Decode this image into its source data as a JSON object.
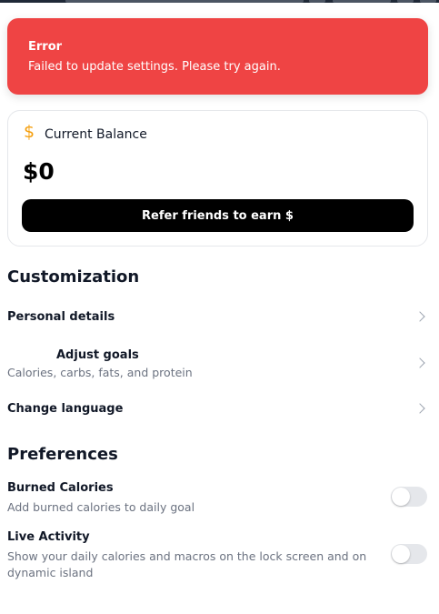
{
  "toast": {
    "title": "Error",
    "message": "Failed to update settings. Please try again.",
    "color": "#ef4444"
  },
  "balance": {
    "icon": "dollar-icon",
    "currency_symbol": "$",
    "label": "Current Balance",
    "amount": "$0",
    "refer_button": "Refer friends to earn $"
  },
  "customization": {
    "title": "Customization",
    "items": [
      {
        "title": "Personal details",
        "icon": "chevron-right-icon"
      },
      {
        "title": "Adjust goals",
        "subtitle": "Calories, carbs, fats, and protein",
        "icon": "chevron-right-icon"
      },
      {
        "title": "Change language",
        "icon": "chevron-right-icon"
      }
    ]
  },
  "preferences": {
    "title": "Preferences",
    "items": [
      {
        "title": "Burned Calories",
        "description": "Add burned calories to daily goal",
        "enabled": false
      },
      {
        "title": "Live Activity",
        "description": "Show your daily calories and macros on the lock screen and on dynamic island",
        "enabled": false
      }
    ]
  }
}
